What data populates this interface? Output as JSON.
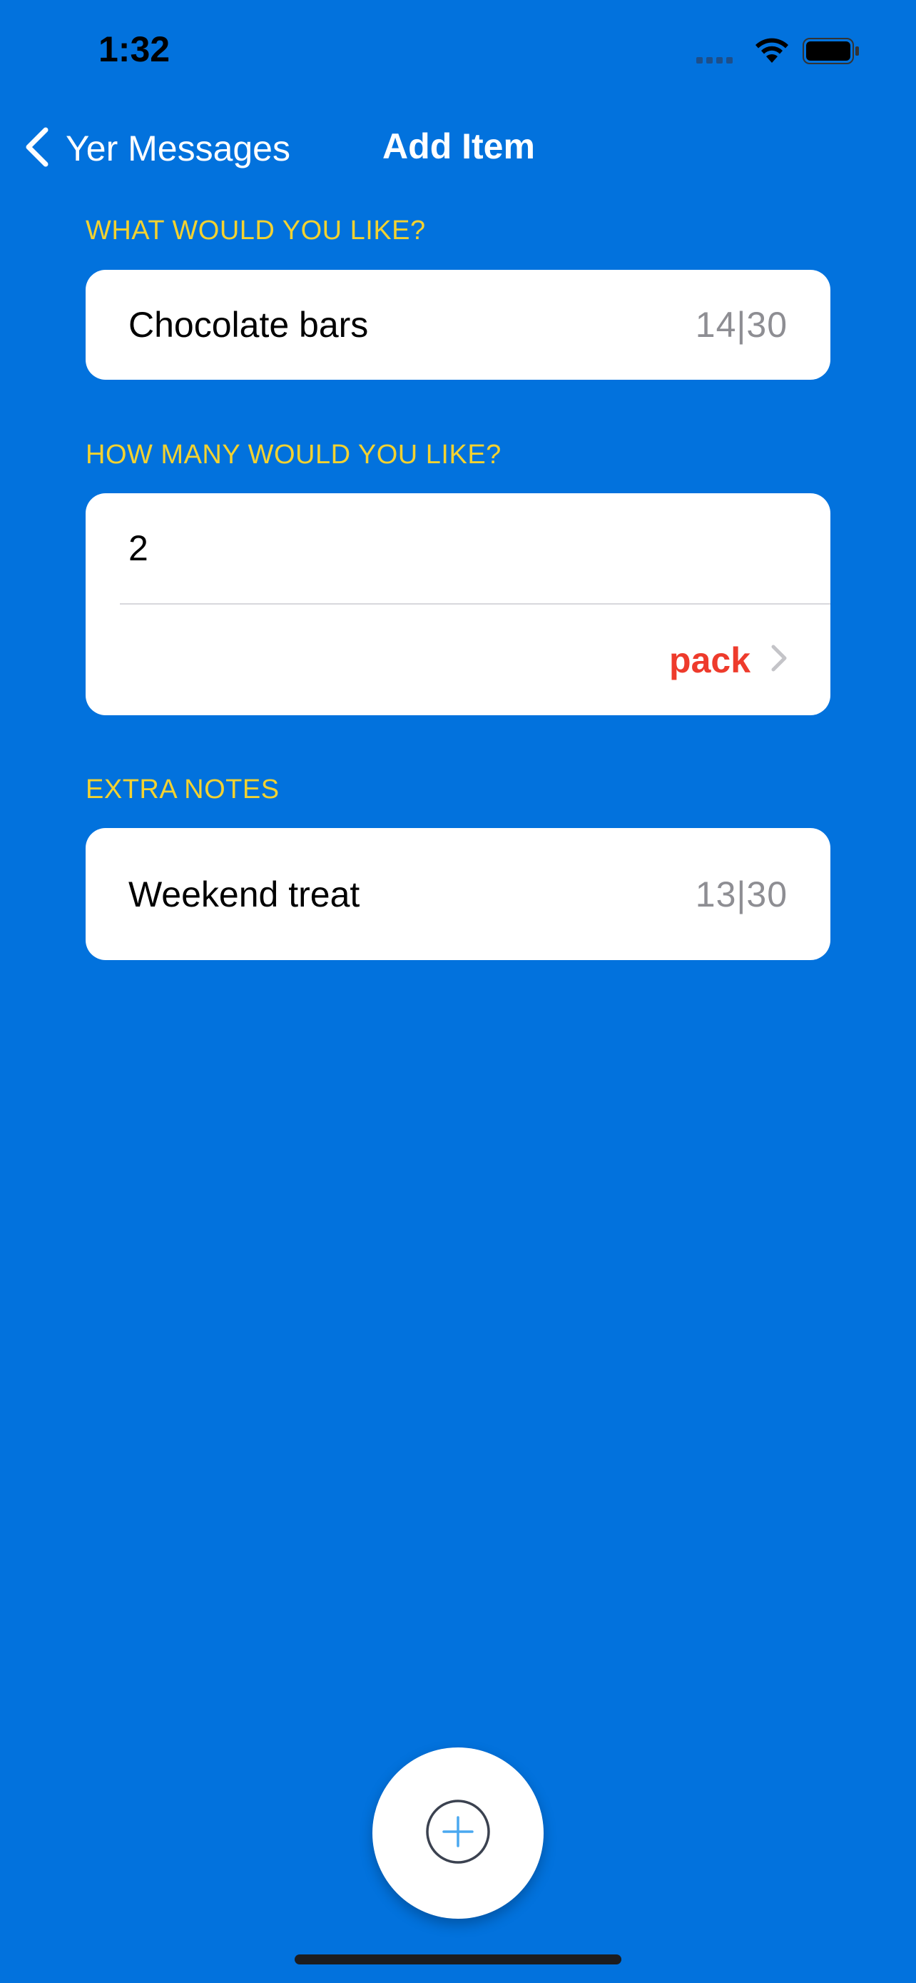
{
  "status_bar": {
    "time": "1:32"
  },
  "nav": {
    "back_label": "Yer Messages",
    "title": "Add Item"
  },
  "sections": {
    "item": {
      "label": "WHAT WOULD YOU LIKE?",
      "value": "Chocolate bars",
      "counter": "14|30"
    },
    "quantity": {
      "label": "HOW MANY WOULD YOU LIKE?",
      "value": "2",
      "unit": "pack"
    },
    "notes": {
      "label": "EXTRA NOTES",
      "value": "Weekend treat",
      "counter": "13|30"
    }
  },
  "icons": {
    "back": "chevron-left-icon",
    "unit_chevron": "chevron-right-icon",
    "add": "plus-circle-icon"
  },
  "colors": {
    "background": "#0272dd",
    "section_label": "#f3d230",
    "unit": "#ee3b2c",
    "counter": "#8e8e93"
  }
}
